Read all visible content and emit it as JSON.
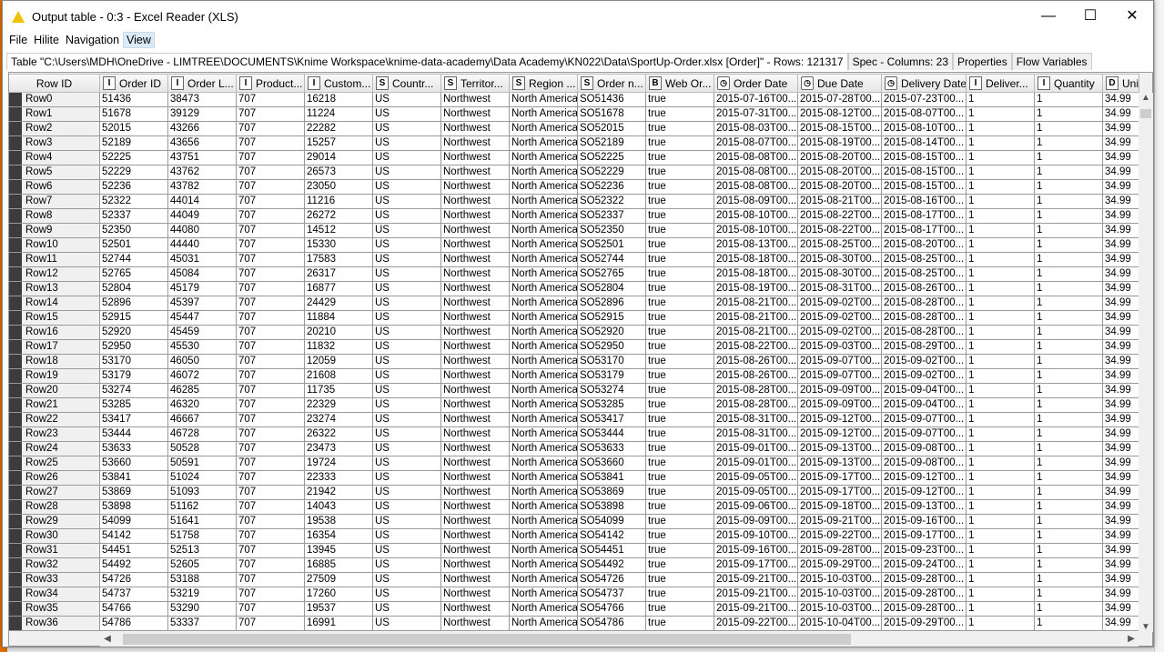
{
  "window": {
    "title": "Output table - 0:3 - Excel Reader (XLS)",
    "minimize": "—",
    "maximize": "☐",
    "close": "✕"
  },
  "menu": [
    "File",
    "Hilite",
    "Navigation",
    "View"
  ],
  "tabs": [
    "Table \"C:\\Users\\MDH\\OneDrive - LIMTREE\\DOCUMENTS\\Knime Workspace\\knime-data-academy\\Data Academy\\KN022\\Data\\SportUp-Order.xlsx [Order]\" - Rows: 121317",
    "Spec - Columns: 23",
    "Properties",
    "Flow Variables"
  ],
  "columns": [
    {
      "label": "Row ID",
      "type": ""
    },
    {
      "label": "Order ID",
      "type": "I"
    },
    {
      "label": "Order L...",
      "type": "I"
    },
    {
      "label": "Product...",
      "type": "I"
    },
    {
      "label": "Custom...",
      "type": "I"
    },
    {
      "label": "Countr...",
      "type": "S"
    },
    {
      "label": "Territor...",
      "type": "S"
    },
    {
      "label": "Region ...",
      "type": "S"
    },
    {
      "label": "Order n...",
      "type": "S"
    },
    {
      "label": "Web Or...",
      "type": "B"
    },
    {
      "label": "Order Date",
      "type": "clock"
    },
    {
      "label": "Due Date",
      "type": "clock"
    },
    {
      "label": "Delivery Date",
      "type": "clock"
    },
    {
      "label": "Deliver...",
      "type": "I"
    },
    {
      "label": "Quantity",
      "type": "I"
    },
    {
      "label": "Unit",
      "type": "D"
    }
  ],
  "rows": [
    [
      "Row0",
      "51436",
      "38473",
      "707",
      "16218",
      "US",
      "Northwest",
      "North America",
      "SO51436",
      "true",
      "2015-07-16T00...",
      "2015-07-28T00...",
      "2015-07-23T00...",
      "1",
      "1",
      "34.99"
    ],
    [
      "Row1",
      "51678",
      "39129",
      "707",
      "11224",
      "US",
      "Northwest",
      "North America",
      "SO51678",
      "true",
      "2015-07-31T00...",
      "2015-08-12T00...",
      "2015-08-07T00...",
      "1",
      "1",
      "34.99"
    ],
    [
      "Row2",
      "52015",
      "43266",
      "707",
      "22282",
      "US",
      "Northwest",
      "North America",
      "SO52015",
      "true",
      "2015-08-03T00...",
      "2015-08-15T00...",
      "2015-08-10T00...",
      "1",
      "1",
      "34.99"
    ],
    [
      "Row3",
      "52189",
      "43656",
      "707",
      "15257",
      "US",
      "Northwest",
      "North America",
      "SO52189",
      "true",
      "2015-08-07T00...",
      "2015-08-19T00...",
      "2015-08-14T00...",
      "1",
      "1",
      "34.99"
    ],
    [
      "Row4",
      "52225",
      "43751",
      "707",
      "29014",
      "US",
      "Northwest",
      "North America",
      "SO52225",
      "true",
      "2015-08-08T00...",
      "2015-08-20T00...",
      "2015-08-15T00...",
      "1",
      "1",
      "34.99"
    ],
    [
      "Row5",
      "52229",
      "43762",
      "707",
      "26573",
      "US",
      "Northwest",
      "North America",
      "SO52229",
      "true",
      "2015-08-08T00...",
      "2015-08-20T00...",
      "2015-08-15T00...",
      "1",
      "1",
      "34.99"
    ],
    [
      "Row6",
      "52236",
      "43782",
      "707",
      "23050",
      "US",
      "Northwest",
      "North America",
      "SO52236",
      "true",
      "2015-08-08T00...",
      "2015-08-20T00...",
      "2015-08-15T00...",
      "1",
      "1",
      "34.99"
    ],
    [
      "Row7",
      "52322",
      "44014",
      "707",
      "11216",
      "US",
      "Northwest",
      "North America",
      "SO52322",
      "true",
      "2015-08-09T00...",
      "2015-08-21T00...",
      "2015-08-16T00...",
      "1",
      "1",
      "34.99"
    ],
    [
      "Row8",
      "52337",
      "44049",
      "707",
      "26272",
      "US",
      "Northwest",
      "North America",
      "SO52337",
      "true",
      "2015-08-10T00...",
      "2015-08-22T00...",
      "2015-08-17T00...",
      "1",
      "1",
      "34.99"
    ],
    [
      "Row9",
      "52350",
      "44080",
      "707",
      "14512",
      "US",
      "Northwest",
      "North America",
      "SO52350",
      "true",
      "2015-08-10T00...",
      "2015-08-22T00...",
      "2015-08-17T00...",
      "1",
      "1",
      "34.99"
    ],
    [
      "Row10",
      "52501",
      "44440",
      "707",
      "15330",
      "US",
      "Northwest",
      "North America",
      "SO52501",
      "true",
      "2015-08-13T00...",
      "2015-08-25T00...",
      "2015-08-20T00...",
      "1",
      "1",
      "34.99"
    ],
    [
      "Row11",
      "52744",
      "45031",
      "707",
      "17583",
      "US",
      "Northwest",
      "North America",
      "SO52744",
      "true",
      "2015-08-18T00...",
      "2015-08-30T00...",
      "2015-08-25T00...",
      "1",
      "1",
      "34.99"
    ],
    [
      "Row12",
      "52765",
      "45084",
      "707",
      "26317",
      "US",
      "Northwest",
      "North America",
      "SO52765",
      "true",
      "2015-08-18T00...",
      "2015-08-30T00...",
      "2015-08-25T00...",
      "1",
      "1",
      "34.99"
    ],
    [
      "Row13",
      "52804",
      "45179",
      "707",
      "16877",
      "US",
      "Northwest",
      "North America",
      "SO52804",
      "true",
      "2015-08-19T00...",
      "2015-08-31T00...",
      "2015-08-26T00...",
      "1",
      "1",
      "34.99"
    ],
    [
      "Row14",
      "52896",
      "45397",
      "707",
      "24429",
      "US",
      "Northwest",
      "North America",
      "SO52896",
      "true",
      "2015-08-21T00...",
      "2015-09-02T00...",
      "2015-08-28T00...",
      "1",
      "1",
      "34.99"
    ],
    [
      "Row15",
      "52915",
      "45447",
      "707",
      "11884",
      "US",
      "Northwest",
      "North America",
      "SO52915",
      "true",
      "2015-08-21T00...",
      "2015-09-02T00...",
      "2015-08-28T00...",
      "1",
      "1",
      "34.99"
    ],
    [
      "Row16",
      "52920",
      "45459",
      "707",
      "20210",
      "US",
      "Northwest",
      "North America",
      "SO52920",
      "true",
      "2015-08-21T00...",
      "2015-09-02T00...",
      "2015-08-28T00...",
      "1",
      "1",
      "34.99"
    ],
    [
      "Row17",
      "52950",
      "45530",
      "707",
      "11832",
      "US",
      "Northwest",
      "North America",
      "SO52950",
      "true",
      "2015-08-22T00...",
      "2015-09-03T00...",
      "2015-08-29T00...",
      "1",
      "1",
      "34.99"
    ],
    [
      "Row18",
      "53170",
      "46050",
      "707",
      "12059",
      "US",
      "Northwest",
      "North America",
      "SO53170",
      "true",
      "2015-08-26T00...",
      "2015-09-07T00...",
      "2015-09-02T00...",
      "1",
      "1",
      "34.99"
    ],
    [
      "Row19",
      "53179",
      "46072",
      "707",
      "21608",
      "US",
      "Northwest",
      "North America",
      "SO53179",
      "true",
      "2015-08-26T00...",
      "2015-09-07T00...",
      "2015-09-02T00...",
      "1",
      "1",
      "34.99"
    ],
    [
      "Row20",
      "53274",
      "46285",
      "707",
      "11735",
      "US",
      "Northwest",
      "North America",
      "SO53274",
      "true",
      "2015-08-28T00...",
      "2015-09-09T00...",
      "2015-09-04T00...",
      "1",
      "1",
      "34.99"
    ],
    [
      "Row21",
      "53285",
      "46320",
      "707",
      "22329",
      "US",
      "Northwest",
      "North America",
      "SO53285",
      "true",
      "2015-08-28T00...",
      "2015-09-09T00...",
      "2015-09-04T00...",
      "1",
      "1",
      "34.99"
    ],
    [
      "Row22",
      "53417",
      "46667",
      "707",
      "23274",
      "US",
      "Northwest",
      "North America",
      "SO53417",
      "true",
      "2015-08-31T00...",
      "2015-09-12T00...",
      "2015-09-07T00...",
      "1",
      "1",
      "34.99"
    ],
    [
      "Row23",
      "53444",
      "46728",
      "707",
      "26322",
      "US",
      "Northwest",
      "North America",
      "SO53444",
      "true",
      "2015-08-31T00...",
      "2015-09-12T00...",
      "2015-09-07T00...",
      "1",
      "1",
      "34.99"
    ],
    [
      "Row24",
      "53633",
      "50528",
      "707",
      "23473",
      "US",
      "Northwest",
      "North America",
      "SO53633",
      "true",
      "2015-09-01T00...",
      "2015-09-13T00...",
      "2015-09-08T00...",
      "1",
      "1",
      "34.99"
    ],
    [
      "Row25",
      "53660",
      "50591",
      "707",
      "19724",
      "US",
      "Northwest",
      "North America",
      "SO53660",
      "true",
      "2015-09-01T00...",
      "2015-09-13T00...",
      "2015-09-08T00...",
      "1",
      "1",
      "34.99"
    ],
    [
      "Row26",
      "53841",
      "51024",
      "707",
      "22333",
      "US",
      "Northwest",
      "North America",
      "SO53841",
      "true",
      "2015-09-05T00...",
      "2015-09-17T00...",
      "2015-09-12T00...",
      "1",
      "1",
      "34.99"
    ],
    [
      "Row27",
      "53869",
      "51093",
      "707",
      "21942",
      "US",
      "Northwest",
      "North America",
      "SO53869",
      "true",
      "2015-09-05T00...",
      "2015-09-17T00...",
      "2015-09-12T00...",
      "1",
      "1",
      "34.99"
    ],
    [
      "Row28",
      "53898",
      "51162",
      "707",
      "14043",
      "US",
      "Northwest",
      "North America",
      "SO53898",
      "true",
      "2015-09-06T00...",
      "2015-09-18T00...",
      "2015-09-13T00...",
      "1",
      "1",
      "34.99"
    ],
    [
      "Row29",
      "54099",
      "51641",
      "707",
      "19538",
      "US",
      "Northwest",
      "North America",
      "SO54099",
      "true",
      "2015-09-09T00...",
      "2015-09-21T00...",
      "2015-09-16T00...",
      "1",
      "1",
      "34.99"
    ],
    [
      "Row30",
      "54142",
      "51758",
      "707",
      "16354",
      "US",
      "Northwest",
      "North America",
      "SO54142",
      "true",
      "2015-09-10T00...",
      "2015-09-22T00...",
      "2015-09-17T00...",
      "1",
      "1",
      "34.99"
    ],
    [
      "Row31",
      "54451",
      "52513",
      "707",
      "13945",
      "US",
      "Northwest",
      "North America",
      "SO54451",
      "true",
      "2015-09-16T00...",
      "2015-09-28T00...",
      "2015-09-23T00...",
      "1",
      "1",
      "34.99"
    ],
    [
      "Row32",
      "54492",
      "52605",
      "707",
      "16885",
      "US",
      "Northwest",
      "North America",
      "SO54492",
      "true",
      "2015-09-17T00...",
      "2015-09-29T00...",
      "2015-09-24T00...",
      "1",
      "1",
      "34.99"
    ],
    [
      "Row33",
      "54726",
      "53188",
      "707",
      "27509",
      "US",
      "Northwest",
      "North America",
      "SO54726",
      "true",
      "2015-09-21T00...",
      "2015-10-03T00...",
      "2015-09-28T00...",
      "1",
      "1",
      "34.99"
    ],
    [
      "Row34",
      "54737",
      "53219",
      "707",
      "17260",
      "US",
      "Northwest",
      "North America",
      "SO54737",
      "true",
      "2015-09-21T00...",
      "2015-10-03T00...",
      "2015-09-28T00...",
      "1",
      "1",
      "34.99"
    ],
    [
      "Row35",
      "54766",
      "53290",
      "707",
      "19537",
      "US",
      "Northwest",
      "North America",
      "SO54766",
      "true",
      "2015-09-21T00...",
      "2015-10-03T00...",
      "2015-09-28T00...",
      "1",
      "1",
      "34.99"
    ],
    [
      "Row36",
      "54786",
      "53337",
      "707",
      "16991",
      "US",
      "Northwest",
      "North America",
      "SO54786",
      "true",
      "2015-09-22T00...",
      "2015-10-04T00...",
      "2015-09-29T00...",
      "1",
      "1",
      "34.99"
    ]
  ]
}
